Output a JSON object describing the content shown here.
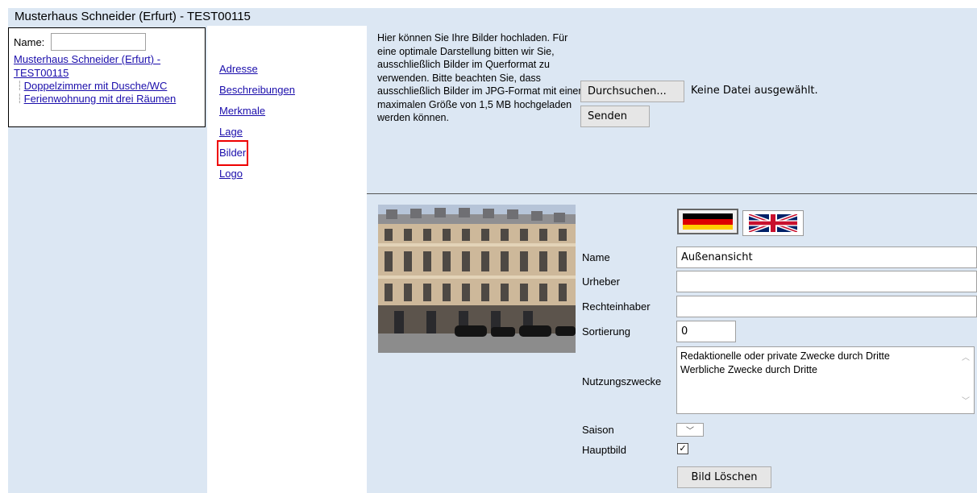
{
  "title": "Musterhaus Schneider (Erfurt) - TEST00115",
  "tree": {
    "name_label": "Name:",
    "name_value": "",
    "root": "Musterhaus Schneider (Erfurt) - TEST00115",
    "children": [
      "Doppelzimmer mit Dusche/WC",
      "Ferienwohnung mit drei Räumen"
    ]
  },
  "nav": {
    "items": [
      "Adresse",
      "Beschreibungen",
      "Merkmale",
      "Lage",
      "Bilder",
      "Logo"
    ],
    "selected": "Bilder"
  },
  "upload": {
    "info": "Hier können Sie Ihre Bilder hochladen. Für eine optimale Darstellung bitten wir Sie, ausschließlich Bilder im Querformat zu verwenden. Bitte beachten Sie, dass ausschließlich Bilder im JPG-Format mit einer maximalen Größe von 1,5 MB hochgeladen werden können.",
    "browse_label": "Durchsuchen...",
    "no_file": "Keine Datei ausgewählt.",
    "send_label": "Senden"
  },
  "image_form": {
    "name_label": "Name",
    "name_value": "Außenansicht",
    "author_label": "Urheber",
    "author_value": "",
    "rights_label": "Rechteinhaber",
    "rights_value": "",
    "sort_label": "Sortierung",
    "sort_value": "0",
    "usage_label": "Nutzungszwecke",
    "usage_options": [
      "Redaktionelle oder private Zwecke durch Dritte",
      "Werbliche Zwecke durch Dritte"
    ],
    "season_label": "Saison",
    "main_label": "Hauptbild",
    "main_checked": true,
    "delete_label": "Bild Löschen"
  },
  "icons": {
    "flag_de": "german-flag-icon",
    "flag_en": "uk-flag-icon",
    "scroll_up": "chevron-up-icon",
    "scroll_down": "chevron-down-icon",
    "dropdown": "chevron-down-icon",
    "check": "checkmark-icon"
  },
  "colors": {
    "panel_bg": "#dce7f3",
    "link": "#1a0dab",
    "selection_outline": "#e00000"
  }
}
